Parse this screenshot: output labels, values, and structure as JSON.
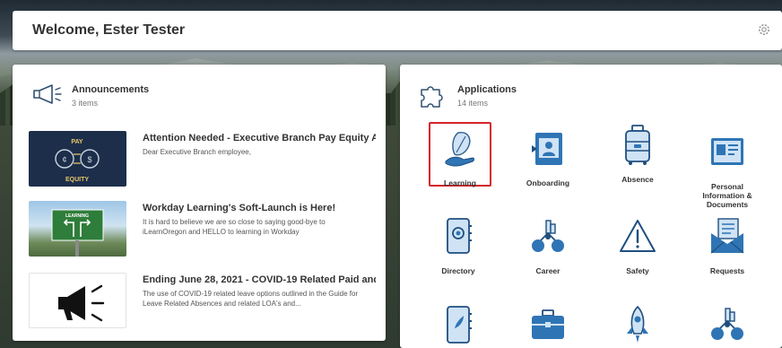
{
  "header": {
    "welcome": "Welcome, Ester Tester"
  },
  "announcements": {
    "title": "Announcements",
    "count": "3 items",
    "items": [
      {
        "title": "Attention Needed - Executive Branch Pay Equity A...",
        "body": "Dear Executive Branch employee,",
        "thumb_line1": "PAY",
        "thumb_line2": "EQUITY"
      },
      {
        "title": "Workday Learning's Soft-Launch is Here!",
        "body": "It is hard to believe we are so close to saying good-bye to iLearnOregon and HELLO to learning in Workday",
        "thumb_line1": "LEARNING"
      },
      {
        "title": "Ending June 28, 2021 - COVID-19 Related Paid and...",
        "body": "The use of COVID-19 related leave options outlined in the Guide for Leave Related Absences and related LOA's and..."
      }
    ]
  },
  "applications": {
    "title": "Applications",
    "count": "14 items",
    "items": [
      {
        "label": "Learning",
        "icon": "learning-icon",
        "selected": true
      },
      {
        "label": "Onboarding",
        "icon": "onboarding-icon"
      },
      {
        "label": "Absence",
        "icon": "absence-icon"
      },
      {
        "label": "Personal Information & Documents",
        "icon": "personal-info-icon"
      },
      {
        "label": "Directory",
        "icon": "directory-icon"
      },
      {
        "label": "Career",
        "icon": "career-icon"
      },
      {
        "label": "Safety",
        "icon": "safety-icon"
      },
      {
        "label": "Requests",
        "icon": "requests-icon"
      },
      {
        "label": "",
        "icon": "notebook-icon"
      },
      {
        "label": "",
        "icon": "briefcase-icon"
      },
      {
        "label": "",
        "icon": "rocket-icon"
      },
      {
        "label": "",
        "icon": "career-icon"
      }
    ]
  },
  "colors": {
    "accent_blue": "#2f75b5",
    "light_blue": "#cfe3f5",
    "selected_border": "#d6242b"
  }
}
